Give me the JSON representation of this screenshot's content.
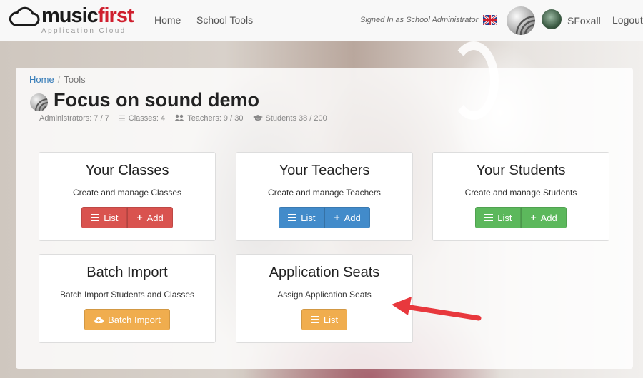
{
  "navbar": {
    "brand_main": "music",
    "brand_accent": "first",
    "brand_sub": "Application Cloud",
    "links": [
      "Home",
      "School Tools"
    ],
    "signed_in": "Signed In as School Administrator",
    "username": "SFoxall",
    "logout": "Logout"
  },
  "breadcrumb": {
    "home": "Home",
    "current": "Tools"
  },
  "page": {
    "title": "Focus on sound demo",
    "stats": {
      "admins": "Administrators: 7 / 7",
      "classes": "Classes: 4",
      "teachers": "Teachers: 9 / 30",
      "students": "Students 38 / 200"
    }
  },
  "cards": {
    "classes": {
      "title": "Your Classes",
      "desc": "Create and manage Classes",
      "list": "List",
      "add": "Add"
    },
    "teachers": {
      "title": "Your Teachers",
      "desc": "Create and manage Teachers",
      "list": "List",
      "add": "Add"
    },
    "students": {
      "title": "Your Students",
      "desc": "Create and manage Students",
      "list": "List",
      "add": "Add"
    },
    "batch": {
      "title": "Batch Import",
      "desc": "Batch Import Students and Classes",
      "button": "Batch Import"
    },
    "seats": {
      "title": "Application Seats",
      "desc": "Assign Application Seats",
      "list": "List"
    }
  },
  "colors": {
    "danger": "#d9534f",
    "primary": "#428bca",
    "success": "#5cb85c",
    "warning": "#f0ad4e",
    "brand_red": "#cf1f2e",
    "annotation_arrow": "#e8383d"
  },
  "icons": [
    "cloud-logo-icon",
    "uk-flag-icon",
    "list-icon",
    "plus-icon",
    "cloud-upload-icon",
    "users-icon",
    "graduation-cap-icon"
  ]
}
